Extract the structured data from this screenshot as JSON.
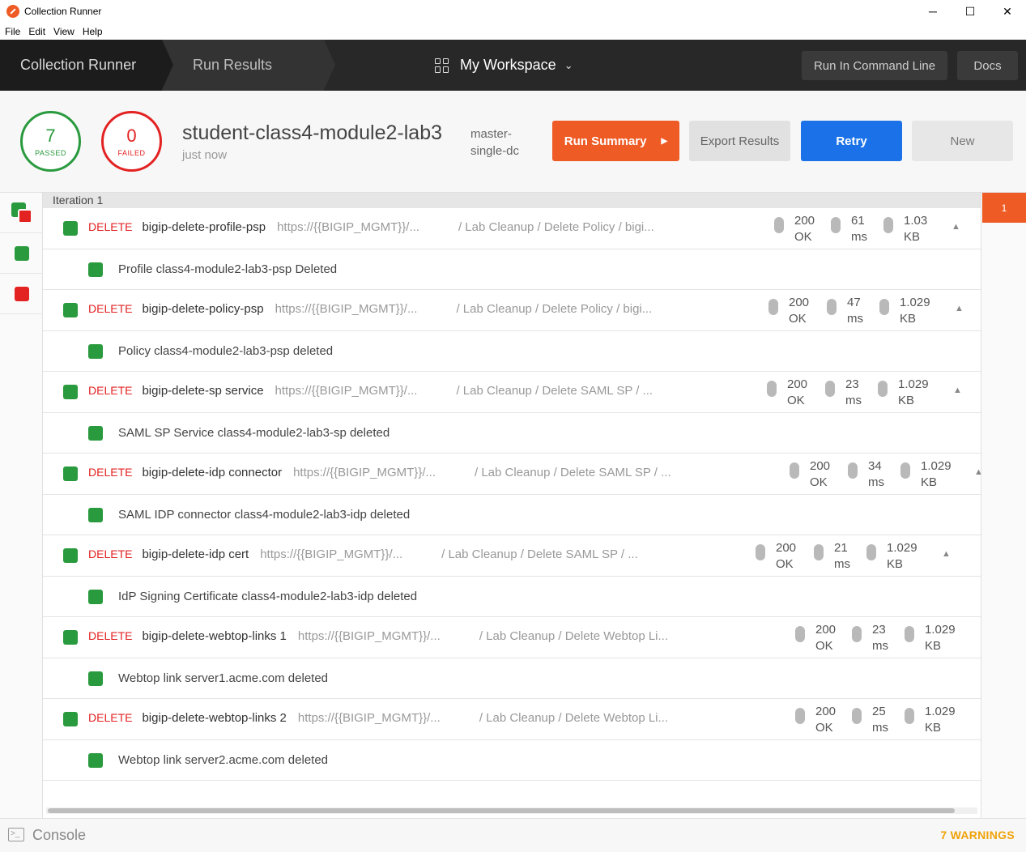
{
  "window": {
    "title": "Collection Runner",
    "controls": {
      "minimize": "─",
      "maximize": "☐",
      "close": "✕"
    }
  },
  "menu": [
    "File",
    "Edit",
    "View",
    "Help"
  ],
  "header": {
    "crumbs": [
      "Collection Runner",
      "Run Results"
    ],
    "workspace": "My Workspace",
    "buttons": {
      "command_line": "Run In Command Line",
      "docs": "Docs"
    }
  },
  "summary": {
    "passed": {
      "count": "7",
      "label": "PASSED"
    },
    "failed": {
      "count": "0",
      "label": "FAILED"
    },
    "run_name": "student-class4-module2-lab3",
    "time": "just now",
    "environment": "master-single-dc",
    "buttons": {
      "run_summary": "Run Summary",
      "export": "Export Results",
      "retry": "Retry",
      "new": "New"
    }
  },
  "iteration": {
    "label": "Iteration 1",
    "badge": "1"
  },
  "results": [
    {
      "method": "DELETE",
      "name": "bigip-delete-profile-psp",
      "url": "https://{{BIGIP_MGMT}}/...",
      "path": "/ Lab Cleanup / Delete Policy / bigi...",
      "status_code": "200",
      "status_text": "OK",
      "time_value": "61",
      "time_unit": "ms",
      "size_value": "1.03",
      "size_unit": "KB",
      "test": "Profile class4-module2-lab3-psp Deleted"
    },
    {
      "method": "DELETE",
      "name": "bigip-delete-policy-psp",
      "url": "https://{{BIGIP_MGMT}}/...",
      "path": "/ Lab Cleanup / Delete Policy / bigi...",
      "status_code": "200",
      "status_text": "OK",
      "time_value": "47",
      "time_unit": "ms",
      "size_value": "1.029",
      "size_unit": "KB",
      "test": "Policy class4-module2-lab3-psp deleted"
    },
    {
      "method": "DELETE",
      "name": "bigip-delete-sp service",
      "url": "https://{{BIGIP_MGMT}}/...",
      "path": "/ Lab Cleanup / Delete SAML SP / ...",
      "status_code": "200",
      "status_text": "OK",
      "time_value": "23",
      "time_unit": "ms",
      "size_value": "1.029",
      "size_unit": "KB",
      "test": "SAML SP Service class4-module2-lab3-sp deleted"
    },
    {
      "method": "DELETE",
      "name": "bigip-delete-idp connector",
      "url": "https://{{BIGIP_MGMT}}/...",
      "path": "/ Lab Cleanup / Delete SAML SP / ...",
      "status_code": "200",
      "status_text": "OK",
      "time_value": "34",
      "time_unit": "ms",
      "size_value": "1.029",
      "size_unit": "KB",
      "test": "SAML IDP connector class4-module2-lab3-idp deleted"
    },
    {
      "method": "DELETE",
      "name": "bigip-delete-idp cert",
      "url": "https://{{BIGIP_MGMT}}/...",
      "path": "/ Lab Cleanup / Delete SAML SP / ...",
      "status_code": "200",
      "status_text": "OK",
      "time_value": "21",
      "time_unit": "ms",
      "size_value": "1.029",
      "size_unit": "KB",
      "test": "IdP Signing Certificate class4-module2-lab3-idp deleted"
    },
    {
      "method": "DELETE",
      "name": "bigip-delete-webtop-links 1",
      "url": "https://{{BIGIP_MGMT}}/...",
      "path": "/ Lab Cleanup / Delete Webtop Li...",
      "status_code": "200",
      "status_text": "OK",
      "time_value": "23",
      "time_unit": "ms",
      "size_value": "1.029",
      "size_unit": "KB",
      "test": "Webtop link server1.acme.com deleted"
    },
    {
      "method": "DELETE",
      "name": "bigip-delete-webtop-links 2",
      "url": "https://{{BIGIP_MGMT}}/...",
      "path": "/ Lab Cleanup / Delete Webtop Li...",
      "status_code": "200",
      "status_text": "OK",
      "time_value": "25",
      "time_unit": "ms",
      "size_value": "1.029",
      "size_unit": "KB",
      "test": "Webtop link server2.acme.com deleted"
    }
  ],
  "footer": {
    "console": "Console",
    "warnings": "7 WARNINGS"
  },
  "colors": {
    "pass": "#2a9a3e",
    "fail": "#e32222",
    "accent": "#ef5b25",
    "retry": "#1b72e8",
    "warning": "#f0a30a"
  }
}
